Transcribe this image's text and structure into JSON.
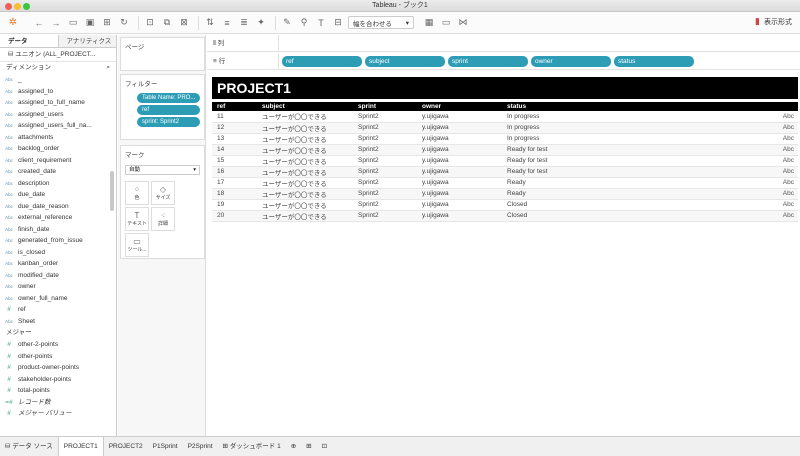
{
  "window": {
    "title": "Tableau - ブック1"
  },
  "toolbar": {
    "fit_select": "幅を合わせる",
    "presentation": "表示形式"
  },
  "left": {
    "tabs": [
      "データ",
      "アナリティクス"
    ],
    "datasource": "ユニオン (ALL_PROJECT...",
    "dimensions_label": "ディメンション",
    "dimensions": [
      {
        "icon": "Abc",
        "name": "_"
      },
      {
        "icon": "Abc",
        "name": "assigned_to"
      },
      {
        "icon": "Abc",
        "name": "assigned_to_full_name"
      },
      {
        "icon": "Abc",
        "name": "assigned_users"
      },
      {
        "icon": "Abc",
        "name": "assigned_users_full_na..."
      },
      {
        "icon": "Abc",
        "name": "attachments"
      },
      {
        "icon": "Abc",
        "name": "backlog_order"
      },
      {
        "icon": "Abc",
        "name": "client_requirement"
      },
      {
        "icon": "Abc",
        "name": "created_date"
      },
      {
        "icon": "Abc",
        "name": "description"
      },
      {
        "icon": "Abc",
        "name": "due_date"
      },
      {
        "icon": "Abc",
        "name": "due_date_reason"
      },
      {
        "icon": "Abc",
        "name": "external_reference"
      },
      {
        "icon": "Abc",
        "name": "finish_date"
      },
      {
        "icon": "Abc",
        "name": "generated_from_issue"
      },
      {
        "icon": "Abc",
        "name": "is_closed"
      },
      {
        "icon": "Abc",
        "name": "kanban_order"
      },
      {
        "icon": "Abc",
        "name": "modified_date"
      },
      {
        "icon": "Abc",
        "name": "owner"
      },
      {
        "icon": "Abc",
        "name": "owner_full_name"
      },
      {
        "icon": "#",
        "name": "ref"
      },
      {
        "icon": "Abc",
        "name": "Sheet"
      }
    ],
    "measures_label": "メジャー",
    "measures": [
      {
        "icon": "#",
        "name": "other-2-points"
      },
      {
        "icon": "#",
        "name": "other-points"
      },
      {
        "icon": "#",
        "name": "product-owner-points"
      },
      {
        "icon": "#",
        "name": "stakeholder-points"
      },
      {
        "icon": "#",
        "name": "total-points"
      },
      {
        "icon": "=#",
        "name": "レコード数"
      },
      {
        "icon": "#",
        "name": "メジャー バリュー"
      }
    ]
  },
  "cards": {
    "pages": "ページ",
    "filters": "フィルター",
    "filter_pills": [
      "Table Name: PRO...",
      "ref",
      "sprint: Sprint2"
    ],
    "marks": "マーク",
    "marks_type": "自動",
    "mark_buttons": [
      "色",
      "サイズ",
      "テキスト",
      "詳細",
      "ツール..."
    ]
  },
  "shelves": {
    "columns_label": "列",
    "rows_label": "行",
    "row_pills": [
      "ref",
      "subject",
      "sprint",
      "owner",
      "status"
    ]
  },
  "view": {
    "title": "PROJECT1",
    "headers": [
      "ref",
      "subject",
      "sprint",
      "owner",
      "status",
      ""
    ],
    "rows": [
      [
        "11",
        "ユーザーが〇〇できる",
        "Sprint2",
        "y.ujigawa",
        "In progress",
        "Abc"
      ],
      [
        "12",
        "ユーザーが〇〇できる",
        "Sprint2",
        "y.ujigawa",
        "In progress",
        "Abc"
      ],
      [
        "13",
        "ユーザーが〇〇できる",
        "Sprint2",
        "y.ujigawa",
        "In progress",
        "Abc"
      ],
      [
        "14",
        "ユーザーが〇〇できる",
        "Sprint2",
        "y.ujigawa",
        "Ready for test",
        "Abc"
      ],
      [
        "15",
        "ユーザーが〇〇できる",
        "Sprint2",
        "y.ujigawa",
        "Ready for test",
        "Abc"
      ],
      [
        "16",
        "ユーザーが〇〇できる",
        "Sprint2",
        "y.ujigawa",
        "Ready for test",
        "Abc"
      ],
      [
        "17",
        "ユーザーが〇〇できる",
        "Sprint2",
        "y.ujigawa",
        "Ready",
        "Abc"
      ],
      [
        "18",
        "ユーザーが〇〇できる",
        "Sprint2",
        "y.ujigawa",
        "Ready",
        "Abc"
      ],
      [
        "19",
        "ユーザーが〇〇できる",
        "Sprint2",
        "y.ujigawa",
        "Closed",
        "Abc"
      ],
      [
        "20",
        "ユーザーが〇〇できる",
        "Sprint2",
        "y.ujigawa",
        "Closed",
        "Abc"
      ]
    ]
  },
  "bottom_tabs": [
    "データ ソース",
    "PROJECT1",
    "PROJECT2",
    "P1Sprint",
    "P2Sprint",
    "ダッシュボード 1"
  ]
}
